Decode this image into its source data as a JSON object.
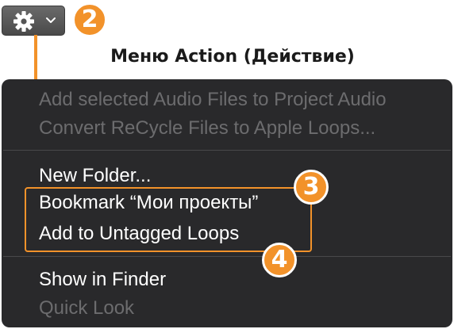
{
  "toolbar": {
    "action_button": {
      "icon": "gear-icon",
      "dropdown_icon": "chevron-down-icon"
    }
  },
  "annotations": {
    "caption": "Меню Action (Действие)",
    "callouts": [
      "2",
      "3",
      "4"
    ],
    "accent_color": "#f2922a"
  },
  "menu": {
    "groups": [
      {
        "items": [
          {
            "label": "Add selected Audio Files to Project Audio",
            "enabled": false
          },
          {
            "label": "Convert ReCycle Files to Apple Loops...",
            "enabled": false
          }
        ]
      },
      {
        "items": [
          {
            "label": "New Folder...",
            "enabled": true
          },
          {
            "label": "Bookmark “Мои проекты”",
            "enabled": true
          },
          {
            "label": "Add to Untagged Loops",
            "enabled": true
          }
        ]
      },
      {
        "items": [
          {
            "label": "Show in Finder",
            "enabled": true
          },
          {
            "label": "Quick Look",
            "enabled": false
          }
        ]
      }
    ]
  },
  "colors": {
    "menu_background": "#29292b",
    "enabled_text": "#ffffff",
    "disabled_text": "#6c6c6e"
  }
}
